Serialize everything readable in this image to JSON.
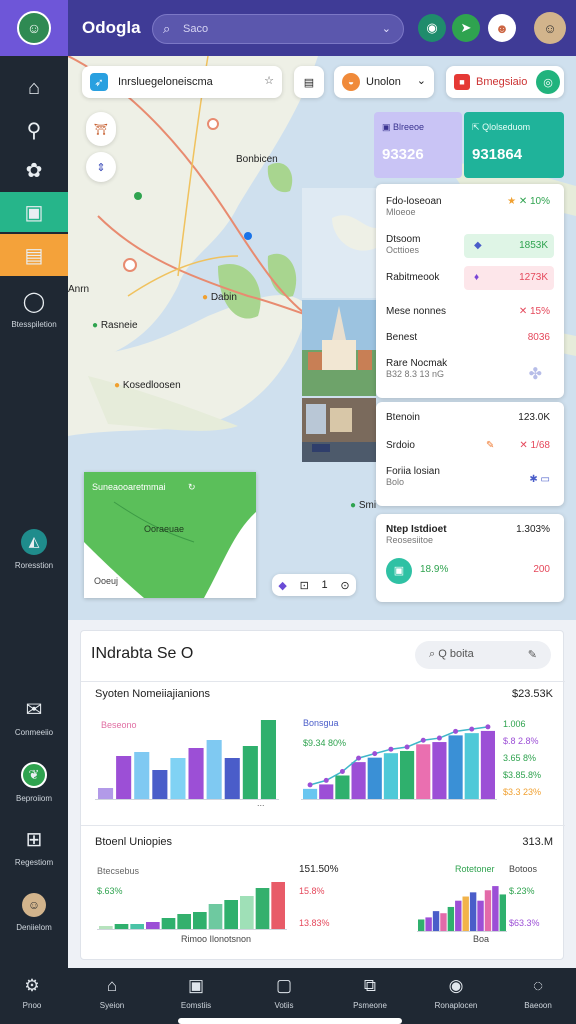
{
  "app": {
    "title": "Odogla",
    "search_placeholder": "Saco"
  },
  "colors": {
    "topbar": "#3f3b96",
    "sidebar": "#1f2833",
    "accent_green": "#26b58a",
    "accent_orange": "#f4a23a",
    "teal": "#1fb39a",
    "lavender": "#c8c4f4"
  },
  "sidebar": {
    "items": [
      {
        "icon": "home-icon",
        "label": ""
      },
      {
        "icon": "wrench-icon",
        "label": ""
      },
      {
        "icon": "puzzle-icon",
        "label": ""
      },
      {
        "icon": "folder-icon",
        "label": ""
      },
      {
        "icon": "document-icon",
        "label": ""
      },
      {
        "icon": "bubble-icon",
        "label": "Btesspiletion"
      },
      {
        "icon": "compass-icon",
        "label": "Roresstion"
      },
      {
        "icon": "chat-icon",
        "label": "Conmeeiio"
      },
      {
        "icon": "leaf-icon",
        "label": "Beproiiom"
      },
      {
        "icon": "grid-icon",
        "label": "Regestiom"
      },
      {
        "icon": "person-icon",
        "label": "Deniielom"
      },
      {
        "icon": "settings-icon",
        "label": "Proo"
      }
    ]
  },
  "map": {
    "search_chip": "Inrsluegeloneiscma",
    "layer_chip": "Unolon",
    "alert_chip": "Bmegsiaio",
    "places": [
      "Bonbicen",
      "Dabin",
      "Rasneie",
      "Kosedloosen",
      "Anrn",
      "Smi"
    ],
    "zoom_value": "1",
    "inset": {
      "title": "Suneaooaretmmai",
      "subtitle": "Ooraeuae",
      "corner": "Ooeuj"
    }
  },
  "kpi": {
    "left": {
      "label": "Blreeoe",
      "value": "93326"
    },
    "right": {
      "label": "Qlolseduom",
      "value": "931864"
    }
  },
  "stats1": [
    {
      "label": "Fdo-loseoan",
      "sub": "Mloeoe",
      "value": "10%"
    },
    {
      "label": "Dtsoom",
      "sub": "Octtioes",
      "value": "1853K"
    },
    {
      "label": "Rabitmeook",
      "sub": "",
      "value": "1273K"
    },
    {
      "label": "Mese nonnes",
      "sub": "",
      "value": "15%"
    },
    {
      "label": "Benest",
      "sub": "",
      "value": "8036"
    },
    {
      "label": "Rare Nocmak",
      "sub": "B32 8.3 13 nG",
      "value": ""
    }
  ],
  "stats2": [
    {
      "label": "Btenoin",
      "value": "123.0K"
    },
    {
      "label": "Srdoio",
      "value": "1/68"
    },
    {
      "label": "Foriia losian",
      "sub": "Bolo",
      "value": ""
    }
  ],
  "stats3": {
    "label": "Ntep Istdioet",
    "sub": "Reosesiitoe",
    "value": "1.303%",
    "pct": "18.9%",
    "amount": "200"
  },
  "analytics": {
    "title": "INdrabta Se O",
    "search_placeholder": "Q boita",
    "panel1": {
      "title": "Syoten Nomeiiajianions",
      "total": "$23.53K",
      "left_tag": "Beseono",
      "right_tag": "Bonsgua",
      "right_value": "$9.34 80%",
      "ticks": [
        "1.006",
        "$.8 2.8%",
        "3.65 8%",
        "$3.85.8%",
        "$3.3 23%"
      ],
      "axis": "..."
    },
    "panel2": {
      "title": "Btoenl Uniopies",
      "total": "313.M",
      "left_tag": "Btecsebus",
      "left_pct": "$.63%",
      "mid_value": "151.50%",
      "mid_pct": "15.8%",
      "mid_low": "13.83%",
      "right_tag": "Rotetoner",
      "right_label": "Botoos",
      "right_pct": "$.23%",
      "right_low": "$63.3%",
      "left_axis": "Rimoo Ilonotsnon",
      "right_axis": "Boa"
    }
  },
  "chart_data": [
    {
      "type": "bar",
      "title": "Syoten Nomeiiajianions",
      "values": [
        12,
        44,
        48,
        30,
        42,
        52,
        60,
        42,
        54,
        80
      ],
      "colors": [
        "#b29ae8",
        "#9c4fd6",
        "#7fc9f2",
        "#4a5dc9",
        "#80d2f4",
        "#9c4fd6",
        "#7fc9f2",
        "#4a5dc9",
        "#2fb06d",
        "#2fb06d"
      ]
    },
    {
      "type": "bar",
      "title": "Bonsgua",
      "values": [
        10,
        14,
        22,
        34,
        38,
        42,
        44,
        50,
        52,
        58,
        60,
        62
      ],
      "colors": [
        "#6ac6f0",
        "#9c4fd6",
        "#2fb06d",
        "#9c4fd6",
        "#3a90d6",
        "#4fc9d8",
        "#2fb06d",
        "#ea6fb0",
        "#9c4fd6",
        "#3a90d6",
        "#4fc9d8",
        "#9c4fd6"
      ]
    },
    {
      "type": "bar",
      "title": "Btoenl Uniopies",
      "values": [
        4,
        6,
        6,
        8,
        12,
        16,
        18,
        26,
        30,
        34,
        42,
        48
      ],
      "colors": [
        "#b6e3bd",
        "#2fb06d",
        "#4ac3a6",
        "#9c4fd6",
        "#2fb06d",
        "#34b06d",
        "#2fb06d",
        "#6ec9a0",
        "#2fb06d",
        "#9fe0b7",
        "#34b06d",
        "#e85b68"
      ]
    },
    {
      "type": "bar",
      "title": "Rotetoner",
      "values": [
        12,
        14,
        20,
        18,
        24,
        30,
        34,
        38,
        30,
        40,
        44,
        36
      ],
      "colors": [
        "#2fb06d",
        "#9c4fd6",
        "#4a5dc9",
        "#e36aa9",
        "#2fb06d",
        "#9c4fd6",
        "#f2b34a",
        "#4a5dc9",
        "#9c4fd6",
        "#e36aa9",
        "#9c4fd6",
        "#2fb06d"
      ]
    }
  ],
  "navbar": {
    "items": [
      {
        "icon": "settings-icon",
        "label": "Pnoo"
      },
      {
        "icon": "home-icon",
        "label": "Syeion"
      },
      {
        "icon": "contacts-icon",
        "label": "Eomstiis"
      },
      {
        "icon": "bag-icon",
        "label": "Votiis"
      },
      {
        "icon": "layers-icon",
        "label": "Psmeone"
      },
      {
        "icon": "account-icon",
        "label": "Ronaplocen"
      },
      {
        "icon": "help-icon",
        "label": "Baeoon"
      }
    ]
  }
}
